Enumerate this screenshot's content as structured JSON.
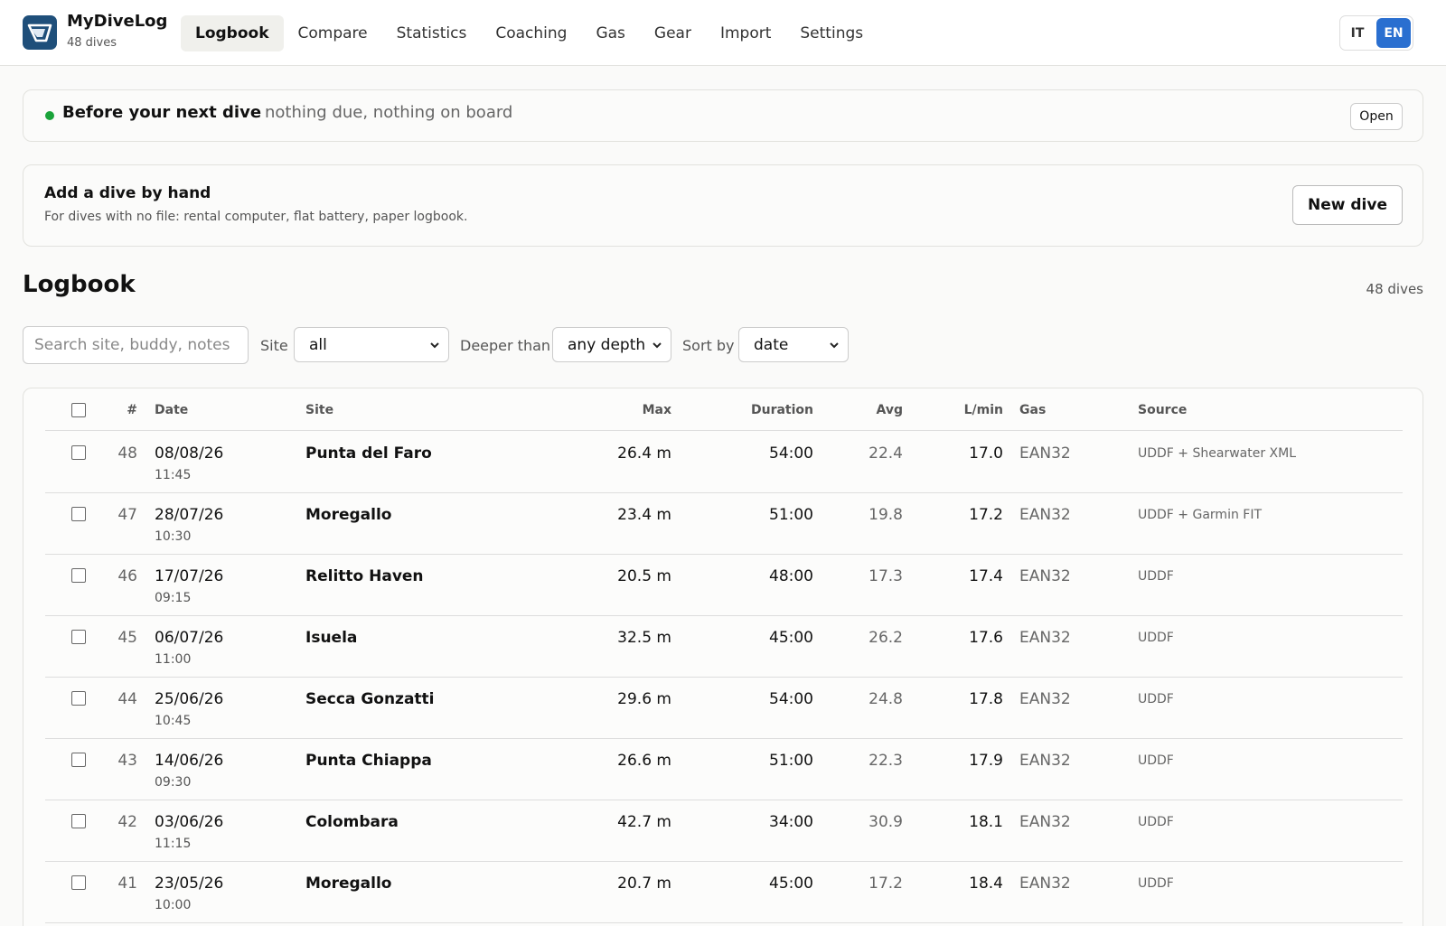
{
  "app": {
    "name": "MyDiveLog",
    "subtitle": "48 dives",
    "logo_icon": "dive-flag-logo-icon",
    "accent": "#2a6fd0"
  },
  "nav": {
    "items": [
      {
        "label": "Logbook",
        "active": true
      },
      {
        "label": "Compare",
        "active": false
      },
      {
        "label": "Statistics",
        "active": false
      },
      {
        "label": "Coaching",
        "active": false
      },
      {
        "label": "Gas",
        "active": false
      },
      {
        "label": "Gear",
        "active": false
      },
      {
        "label": "Import",
        "active": false
      },
      {
        "label": "Settings",
        "active": false
      }
    ]
  },
  "lang": {
    "it": "IT",
    "en": "EN",
    "selected": "EN"
  },
  "next_dive": {
    "title": "Before your next dive",
    "text": "nothing due, nothing on board",
    "open_label": "Open",
    "status_color": "#1aa33a"
  },
  "add_dive": {
    "title": "Add a dive by hand",
    "text": "For dives with no file: rental computer, flat battery, paper logbook.",
    "button_label": "New dive"
  },
  "logbook": {
    "title": "Logbook",
    "count": "48 dives"
  },
  "filters": {
    "search_placeholder": "Search site, buddy, notes",
    "site_label": "Site",
    "site_value": "all",
    "depth_label": "Deeper than",
    "depth_value": "any depth",
    "sort_label": "Sort by",
    "sort_value": "date"
  },
  "table": {
    "columns": {
      "num": "#",
      "date": "Date",
      "site": "Site",
      "max": "Max",
      "duration": "Duration",
      "avg": "Avg",
      "lmin": "L/min",
      "gas": "Gas",
      "source": "Source"
    },
    "rows": [
      {
        "num": "48",
        "date": "08/08/26",
        "time": "11:45",
        "site": "Punta del Faro",
        "max": "26.4 m",
        "duration": "54:00",
        "avg": "22.4",
        "lmin": "17.0",
        "gas": "EAN32",
        "source": "UDDF + Shearwater XML"
      },
      {
        "num": "47",
        "date": "28/07/26",
        "time": "10:30",
        "site": "Moregallo",
        "max": "23.4 m",
        "duration": "51:00",
        "avg": "19.8",
        "lmin": "17.2",
        "gas": "EAN32",
        "source": "UDDF + Garmin FIT"
      },
      {
        "num": "46",
        "date": "17/07/26",
        "time": "09:15",
        "site": "Relitto Haven",
        "max": "20.5 m",
        "duration": "48:00",
        "avg": "17.3",
        "lmin": "17.4",
        "gas": "EAN32",
        "source": "UDDF"
      },
      {
        "num": "45",
        "date": "06/07/26",
        "time": "11:00",
        "site": "Isuela",
        "max": "32.5 m",
        "duration": "45:00",
        "avg": "26.2",
        "lmin": "17.6",
        "gas": "EAN32",
        "source": "UDDF"
      },
      {
        "num": "44",
        "date": "25/06/26",
        "time": "10:45",
        "site": "Secca Gonzatti",
        "max": "29.6 m",
        "duration": "54:00",
        "avg": "24.8",
        "lmin": "17.8",
        "gas": "EAN32",
        "source": "UDDF"
      },
      {
        "num": "43",
        "date": "14/06/26",
        "time": "09:30",
        "site": "Punta Chiappa",
        "max": "26.6 m",
        "duration": "51:00",
        "avg": "22.3",
        "lmin": "17.9",
        "gas": "EAN32",
        "source": "UDDF"
      },
      {
        "num": "42",
        "date": "03/06/26",
        "time": "11:15",
        "site": "Colombara",
        "max": "42.7 m",
        "duration": "34:00",
        "avg": "30.9",
        "lmin": "18.1",
        "gas": "EAN32",
        "source": "UDDF"
      },
      {
        "num": "41",
        "date": "23/05/26",
        "time": "10:00",
        "site": "Moregallo",
        "max": "20.7 m",
        "duration": "45:00",
        "avg": "17.2",
        "lmin": "18.4",
        "gas": "EAN32",
        "source": "UDDF"
      }
    ]
  }
}
